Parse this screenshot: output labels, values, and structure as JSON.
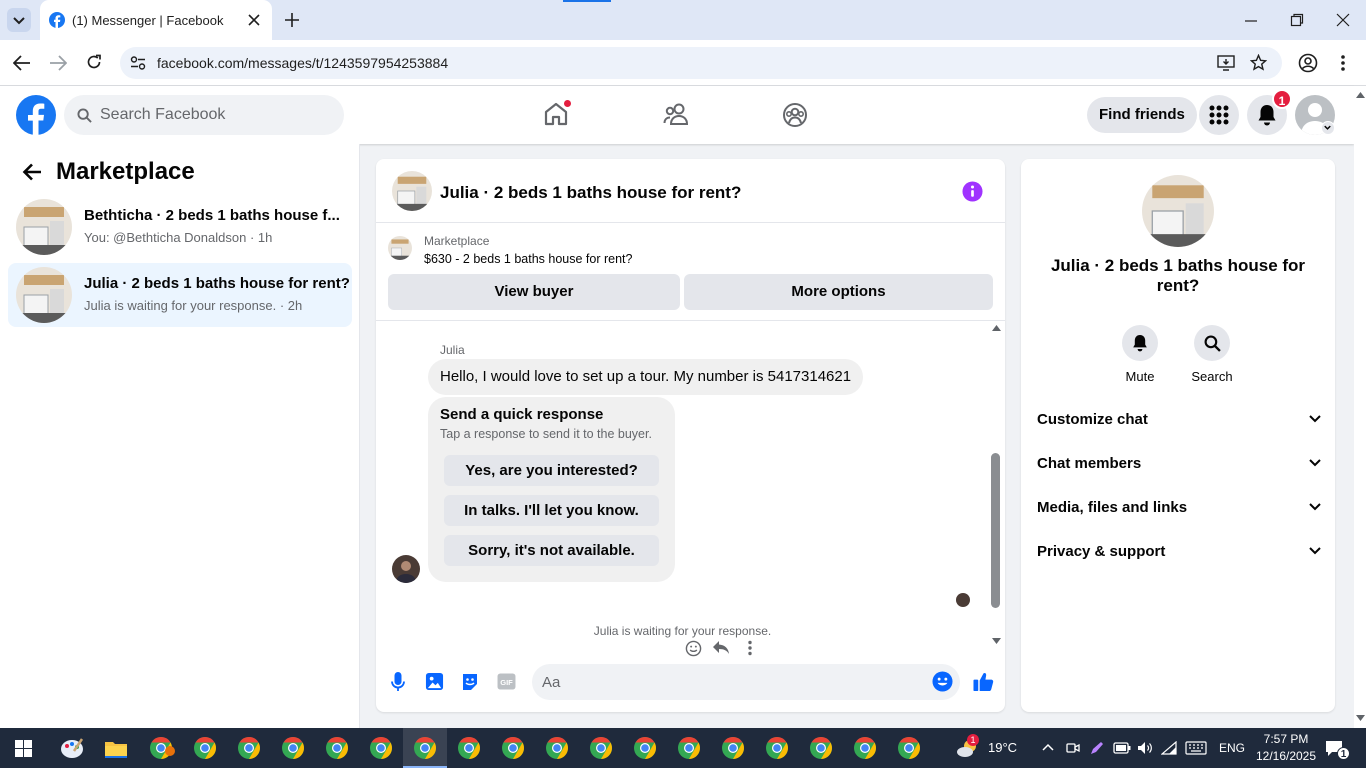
{
  "browser": {
    "tab_title": "(1) Messenger | Facebook",
    "url": "facebook.com/messages/t/1243597954253884"
  },
  "fb_header": {
    "search_placeholder": "Search Facebook",
    "find_friends_label": "Find friends",
    "notification_count": "1"
  },
  "sidebar": {
    "title": "Marketplace",
    "conversations": [
      {
        "title": "Bethticha · 2 beds 1 baths house f...",
        "subtitle": "You: @Bethticha Donaldson · 1h",
        "active": false
      },
      {
        "title": "Julia · 2 beds 1 baths house for rent?",
        "subtitle": "Julia is waiting for your response. · 2h",
        "active": true
      }
    ]
  },
  "chat": {
    "title": "Julia · 2 beds 1 baths house for rent?",
    "listing_label": "Marketplace",
    "listing_price": "$630 - 2 beds 1 baths house for rent?",
    "view_buyer_label": "View buyer",
    "more_options_label": "More options",
    "sender_name": "Julia",
    "message": "Hello, I would love to set up a tour. My number is 5417314621",
    "quick_title": "Send a quick response",
    "quick_subtitle": "Tap a response to send it to the buyer.",
    "quick_responses": [
      "Yes, are you interested?",
      "In talks. I'll let you know.",
      "Sorry, it's not available."
    ],
    "waiting_text": "Julia is waiting for your response.",
    "composer_placeholder": "Aa"
  },
  "info_panel": {
    "title": "Julia · 2 beds 1 baths house for rent?",
    "mute_label": "Mute",
    "search_label": "Search",
    "sections": [
      "Customize chat",
      "Chat members",
      "Media, files and links",
      "Privacy & support"
    ]
  },
  "taskbar": {
    "temperature": "19°C",
    "language": "ENG",
    "time": "7:57 PM",
    "date": "12/16/2025",
    "notification_count": "1",
    "weather_badge": "1"
  },
  "colors": {
    "facebook_blue": "#1877f2",
    "messenger_purple": "#a033ff",
    "badge_red": "#e41e3f",
    "active_conversation_bg": "#ebf5ff"
  }
}
